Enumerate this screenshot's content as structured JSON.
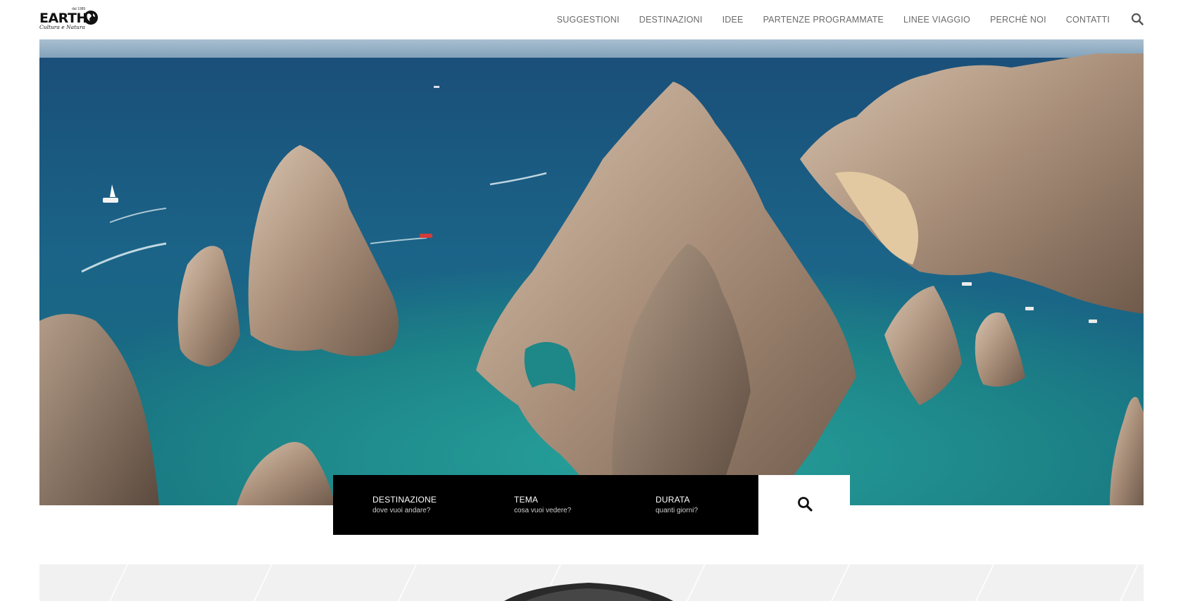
{
  "header": {
    "logo": {
      "word": "EARTH",
      "since": "dal 1989",
      "tagline": "Cultura e Natura"
    },
    "nav": [
      {
        "label": "SUGGESTIONI"
      },
      {
        "label": "DESTINAZIONI"
      },
      {
        "label": "IDEE"
      },
      {
        "label": "PARTENZE PROGRAMMATE"
      },
      {
        "label": "LINEE VIAGGIO"
      },
      {
        "label": "PERCHÈ NOI"
      },
      {
        "label": "CONTATTI"
      }
    ],
    "search_icon": "search-icon"
  },
  "hero": {
    "image": "aerial view of rocky sea arch and turquoise water",
    "colors": {
      "sea": "#1d6a8a",
      "shallow": "#1f8c8a",
      "rock": "#b49a84"
    }
  },
  "search": {
    "fields": [
      {
        "label": "DESTINAZIONE",
        "placeholder": "dove vuoi andare?"
      },
      {
        "label": "TEMA",
        "placeholder": "cosa vuoi vedere?"
      },
      {
        "label": "DURATA",
        "placeholder": "quanti giorni?"
      }
    ],
    "button_icon": "search-icon"
  }
}
